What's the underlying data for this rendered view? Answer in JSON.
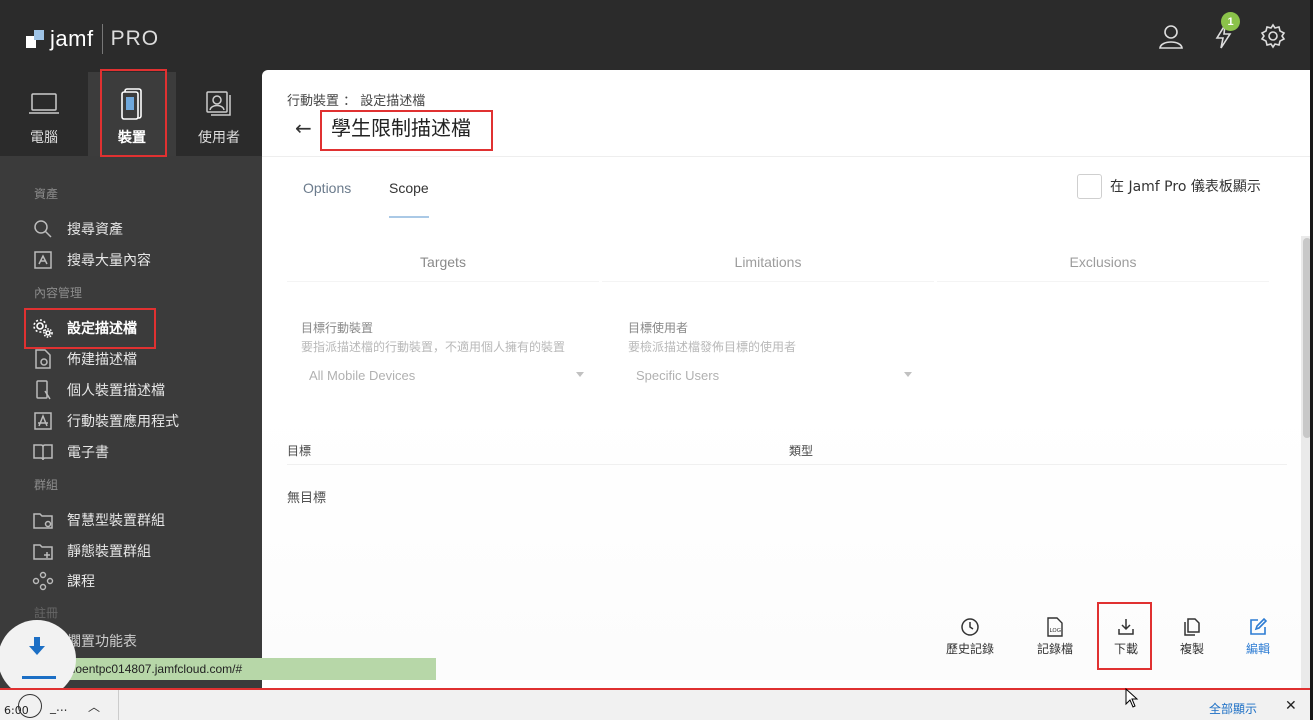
{
  "app": {
    "logo_text": "jamf",
    "logo_suffix": "PRO",
    "notification_count": "1"
  },
  "nav_tabs": [
    {
      "label": "電腦",
      "icon": "laptop-icon"
    },
    {
      "label": "裝置",
      "icon": "mobile-device-icon"
    },
    {
      "label": "使用者",
      "icon": "users-icon"
    }
  ],
  "sidebar": {
    "sections": {
      "assets": "資產",
      "content": "內容管理",
      "groups": "群組",
      "settings": "註冊"
    },
    "items": [
      {
        "label": "搜尋資產",
        "icon": "search-icon"
      },
      {
        "label": "搜尋大量內容",
        "icon": "search-bulk-icon"
      },
      {
        "label": "設定描述檔",
        "icon": "gears-icon"
      },
      {
        "label": "佈建描述檔",
        "icon": "provisioning-icon"
      },
      {
        "label": "個人裝置描述檔",
        "icon": "personal-device-icon"
      },
      {
        "label": "行動裝置應用程式",
        "icon": "app-store-icon"
      },
      {
        "label": "電子書",
        "icon": "book-icon"
      },
      {
        "label": "智慧型裝置群組",
        "icon": "smart-group-icon"
      },
      {
        "label": "靜態裝置群組",
        "icon": "static-group-icon"
      },
      {
        "label": "課程",
        "icon": "classes-icon"
      },
      {
        "label": "擱置功能表",
        "icon": "pending-icon"
      }
    ]
  },
  "main": {
    "breadcrumb": "行動裝置 ： 設定描述檔",
    "title": "學生限制描述檔",
    "tabs": [
      "Options",
      "Scope"
    ],
    "dashboard_checkbox_label": "在 Jamf Pro 儀表板顯示",
    "segments": [
      "Targets",
      "Limitations",
      "Exclusions"
    ],
    "target_devices": {
      "label": "目標行動裝置",
      "help": "要指派描述檔的行動裝置，不適用個人擁有的裝置",
      "value": "All Mobile Devices"
    },
    "target_users": {
      "label": "目標使用者",
      "help": "要檢派描述檔發佈目標的使用者",
      "value": "Specific Users"
    },
    "table_headers": [
      "目標",
      "類型"
    ],
    "empty_text": "無目標",
    "actions": [
      {
        "label": "歷史記錄",
        "icon": "history-icon"
      },
      {
        "label": "記錄檔",
        "icon": "log-icon"
      },
      {
        "label": "下載",
        "icon": "download-icon"
      },
      {
        "label": "複製",
        "icon": "clone-icon"
      },
      {
        "label": "編輯",
        "icon": "edit-icon"
      }
    ]
  },
  "browser": {
    "status_url": "phoentpc014807.jamfcloud.com/#",
    "clock": "6:00",
    "download_file": "_...",
    "show_all": "全部顯示",
    "close": "✕"
  },
  "colors": {
    "accent": "#2d7cd3",
    "highlight": "#e03131",
    "badge": "#8bc34a"
  }
}
